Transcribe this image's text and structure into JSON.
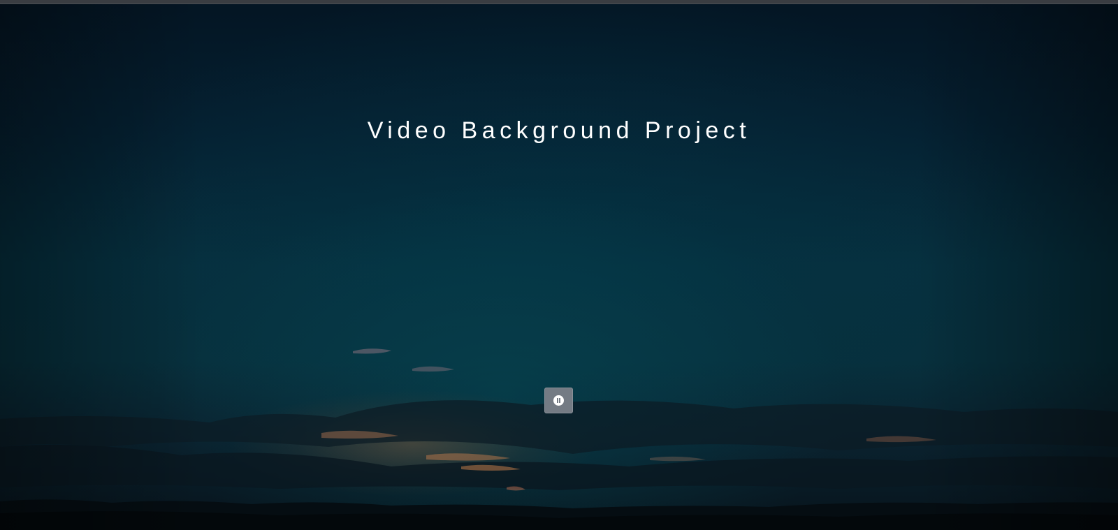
{
  "hero": {
    "title": "Video Background Project"
  },
  "controls": {
    "pause_icon": "pause-circle-icon"
  },
  "colors": {
    "sky_top": "#041523",
    "sky_mid": "#06303f",
    "button_bg": "#747b84",
    "title_text": "#ffffff"
  }
}
